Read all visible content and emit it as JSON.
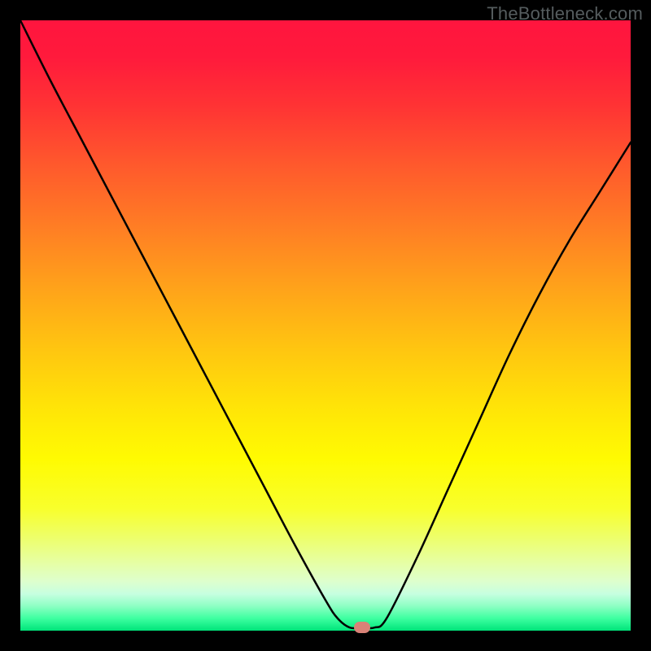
{
  "attribution": "TheBottleneck.com",
  "colors": {
    "marker": "#d98277",
    "curve": "#000000"
  },
  "chart_data": {
    "type": "line",
    "title": "",
    "xlabel": "",
    "ylabel": "",
    "xlim": [
      0,
      100
    ],
    "ylim": [
      0,
      100
    ],
    "grid": false,
    "curve_note": "Bottleneck V-curve; y is mismatch percentage (0 = optimal, 100 = worst). Curve drops from top-left to the optimal point then rises toward top-right.",
    "x": [
      0,
      5,
      10,
      15,
      20,
      25,
      30,
      35,
      40,
      45,
      50,
      52,
      54,
      56,
      58,
      60,
      65,
      70,
      75,
      80,
      85,
      90,
      95,
      100
    ],
    "y": [
      100,
      90,
      80.5,
      71,
      61.5,
      52,
      42.5,
      33,
      23.5,
      14,
      5,
      2,
      0.5,
      0.5,
      0.5,
      2,
      12,
      23,
      34,
      45,
      55,
      64,
      72,
      80
    ],
    "optimal_point": {
      "x": 56,
      "y": 0.5
    },
    "background_gradient": "red (top / high mismatch) through orange, yellow, to green (bottom / low mismatch)"
  }
}
